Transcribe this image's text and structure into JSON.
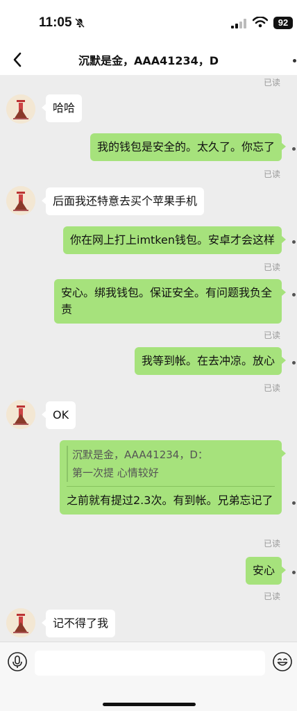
{
  "status_bar": {
    "time": "11:05",
    "battery": "92",
    "icons": [
      "bell-slash-icon",
      "cellular-signal-icon",
      "wifi-icon",
      "battery-icon"
    ]
  },
  "header": {
    "title": "沉默是金，AAA41234，D",
    "icons": [
      "back-chevron-icon",
      "more-icon"
    ]
  },
  "read_label": "已读",
  "messages": [
    {
      "side": "left",
      "text": "哈哈"
    },
    {
      "side": "right",
      "text": "我的钱包是安全的。太久了。你忘了"
    },
    {
      "side": "left",
      "text": "后面我还特意去买个苹果手机"
    },
    {
      "side": "right",
      "text": "你在网上打上imtken钱包。安卓才会这样"
    },
    {
      "side": "right",
      "text": "安心。绑我钱包。保证安全。有问题我负全责"
    },
    {
      "side": "right",
      "text": "我等到帐。在去冲凉。放心"
    },
    {
      "side": "left",
      "text": "OK"
    },
    {
      "side": "right",
      "quote_author": "沉默是金，AAA41234，D：",
      "quote_text": "第一次提 心情较好",
      "text": "之前就有提过2.3次。有到帐。兄弟忘记了"
    },
    {
      "side": "right",
      "text": "安心"
    },
    {
      "side": "left",
      "text": "记不得了我"
    }
  ],
  "input_bar": {
    "placeholder": "",
    "icons": [
      "microphone-icon",
      "emoji-icon"
    ]
  },
  "colors": {
    "sent_bubble": "#a6e27c",
    "received_bubble": "#ffffff",
    "chat_background": "#ededed"
  }
}
